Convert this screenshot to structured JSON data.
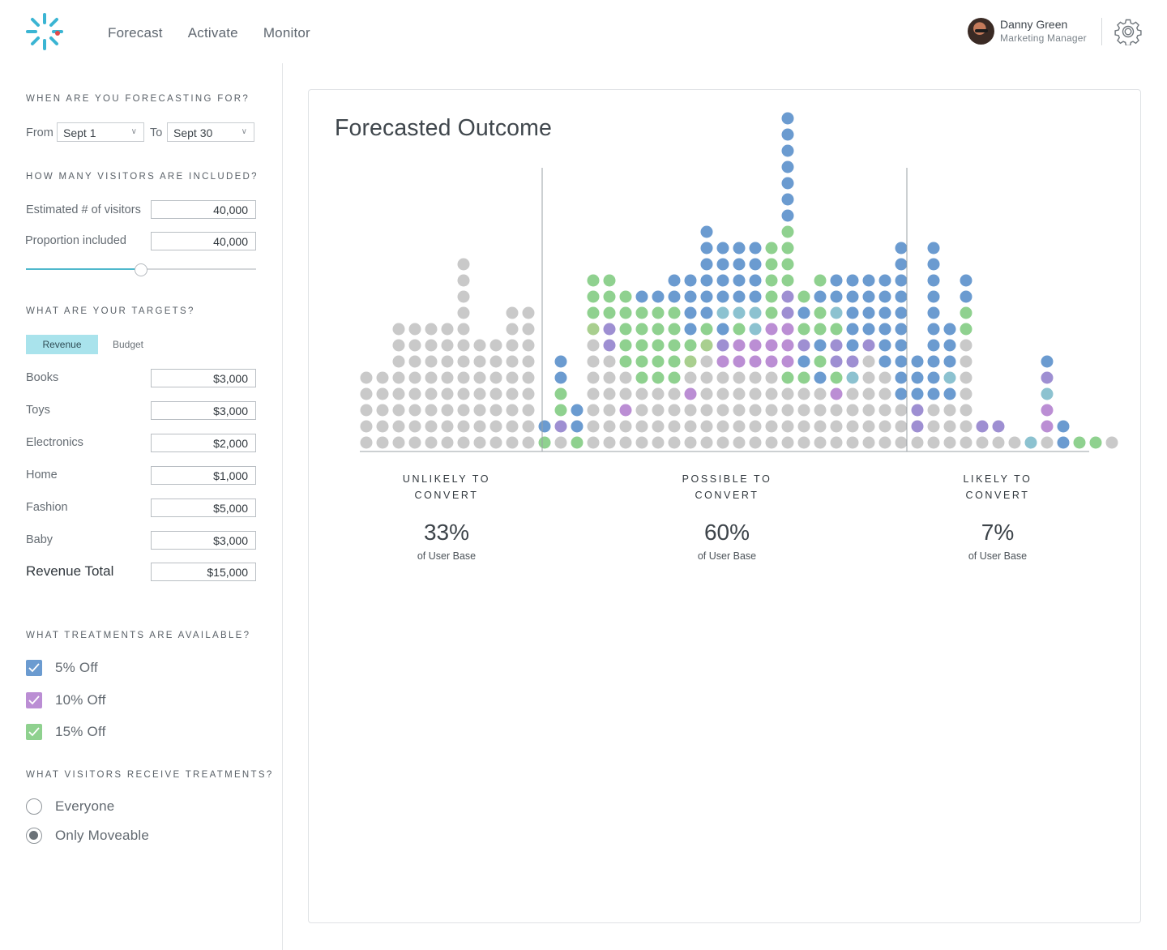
{
  "nav": {
    "items": [
      "Forecast",
      "Activate",
      "Monitor"
    ]
  },
  "user": {
    "name": "Danny Green",
    "role": "Marketing Manager"
  },
  "sidebar": {
    "forecast_section": {
      "title": "WHEN ARE YOU FORECASTING FOR?",
      "from_label": "From",
      "from_value": "Sept 1",
      "to_label": "To",
      "to_value": "Sept 30"
    },
    "visitors_section": {
      "title": "HOW MANY VISITORS ARE INCLUDED?",
      "estimated_label": "Estimated # of visitors",
      "estimated_value": "40,000",
      "proportion_label": "Proportion included",
      "proportion_value": "40,000",
      "slider_level": 0.5
    },
    "targets_section": {
      "title": "WHAT ARE YOUR TARGETS?",
      "tabs": [
        "Revenue",
        "Budget"
      ],
      "active_tab": "Revenue",
      "rows": [
        {
          "label": "Books",
          "value": "$3,000"
        },
        {
          "label": "Toys",
          "value": "$3,000"
        },
        {
          "label": "Electronics",
          "value": "$2,000"
        },
        {
          "label": "Home",
          "value": "$1,000"
        },
        {
          "label": "Fashion",
          "value": "$5,000"
        },
        {
          "label": "Baby",
          "value": "$3,000"
        }
      ],
      "total_label": "Revenue Total",
      "total_value": "$15,000"
    },
    "treatments_section": {
      "title": "WHAT TREATMENTS ARE AVAILABLE?",
      "items": [
        {
          "label": "5% Off",
          "checked": true,
          "color": "#6b9bd0"
        },
        {
          "label": "10% Off",
          "checked": true,
          "color": "#bb8ed4"
        },
        {
          "label": "15% Off",
          "checked": true,
          "color": "#8fd18f"
        }
      ]
    },
    "recipients_section": {
      "title": "WHAT VISITORS RECEIVE TREATMENTS?",
      "options": [
        {
          "label": "Everyone",
          "selected": false
        },
        {
          "label": "Only Moveable",
          "selected": true
        }
      ]
    }
  },
  "main": {
    "title": "Forecasted Outcome",
    "bands": [
      {
        "label": "UNLIKELY TO\nCONVERT",
        "percent": "33%",
        "sub": "of User Base"
      },
      {
        "label": "POSSIBLE TO\nCONVERT",
        "percent": "60%",
        "sub": "of User Base"
      },
      {
        "label": "LIKELY  TO\nCONVERT",
        "percent": "7%",
        "sub": "of User Base"
      }
    ]
  },
  "colors": {
    "accent": "#4fb8cc",
    "untreated": "#c9c9c9",
    "blue": "#6b9bd0",
    "purple": "#9e8fd2",
    "magenta": "#bb8ed4",
    "green": "#8fd18f",
    "teal": "#8cc2d0",
    "olive": "#a9cf8f"
  },
  "chart_data": {
    "type": "scatter",
    "description_key": "dot-plot; each column is a stack of visitor dots, bottom to top. Codes: g=untreated gray, b=blue(5% off), p=purple, m=magenta(10% off), l=light green(15% off), t=teal, o=olive green",
    "columns": [
      "ggggg",
      "ggggg",
      "gggggggg",
      "gggggggg",
      "gggggggg",
      "gggggggg",
      "gggggggggggg",
      "ggggggg",
      "ggggggg",
      "ggggggggg",
      "ggggggggg",
      "lb",
      "gpllbb",
      "lbb",
      "gggggggolll",
      "ggggggpplll",
      "ggmgglllll",
      "gggglllllb",
      "gggglllllb",
      "gggglllllbb",
      "gggmgolbbbb",
      "ggggggolbbbbbb",
      "gggggmpbtbbbb",
      "gggggmmltbbbb",
      "gggggmmttbbbb",
      "gggggmmmlllll",
      "gggglmmmppllllbbbbbbb",
      "gggglbplbl",
      "ggggblbllbl",
      "gggmlppltbb",
      "ggggtpbbbbb",
      "ggggggpbbbb",
      "gggggbbbbbb",
      "gggbbbbbbbbbb",
      "gppbbb",
      "gggbbbbbbbbbb",
      "gggbtbbb",
      "gggggggllbb",
      "gp",
      "gp",
      "g",
      "t",
      "gmmtpb",
      "bb",
      "l",
      "l",
      "g"
    ]
  }
}
